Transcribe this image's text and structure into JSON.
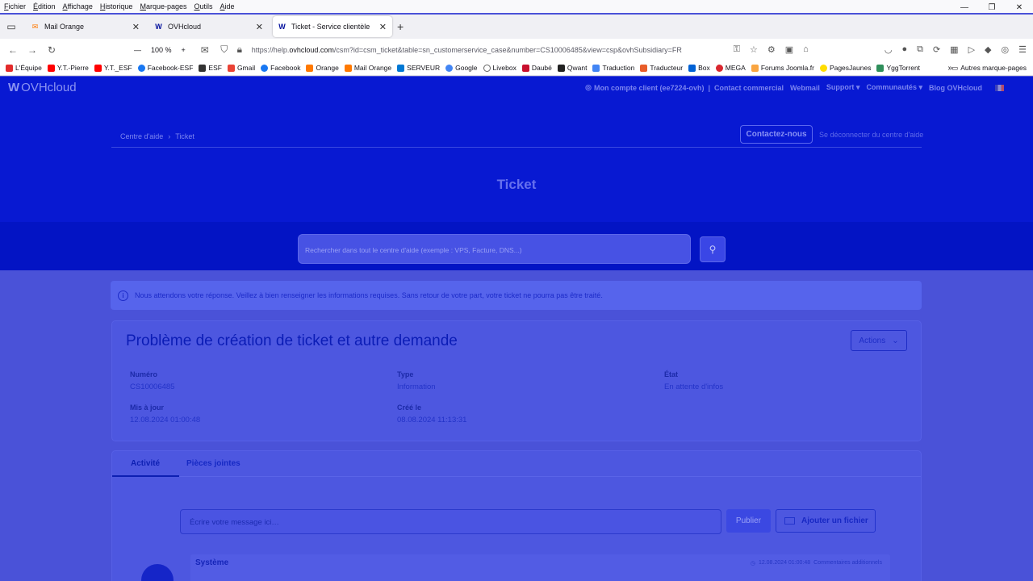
{
  "menubar": [
    "Fichier",
    "Édition",
    "Affichage",
    "Historique",
    "Marque-pages",
    "Outils",
    "Aide"
  ],
  "tabs": [
    {
      "label": "Mail Orange",
      "active": false
    },
    {
      "label": "OVHcloud",
      "active": false
    },
    {
      "label": "Ticket - Service clientèle",
      "active": true
    }
  ],
  "navbar": {
    "zoom": "100 %",
    "url_prefix": "https://help.",
    "url_host": "ovhcloud.com",
    "url_path": "/csm?id=csm_ticket&table=sn_customerservice_case&number=CS10006485&view=csp&ovhSubsidiary=FR"
  },
  "bookmarks": [
    {
      "label": "L'Équipe",
      "color": "#e32b2b"
    },
    {
      "label": "Y.T.-Pierre",
      "color": "#ff0000"
    },
    {
      "label": "Y.T._ESF",
      "color": "#ff0000"
    },
    {
      "label": "Facebook-ESF",
      "color": "#1877f2"
    },
    {
      "label": "ESF",
      "color": "#333333"
    },
    {
      "label": "Gmail",
      "color": "#ea4335"
    },
    {
      "label": "Facebook",
      "color": "#1877f2"
    },
    {
      "label": "Orange",
      "color": "#ff7900"
    },
    {
      "label": "Mail Orange",
      "color": "#ff7900"
    },
    {
      "label": "SERVEUR",
      "color": "#0078d4"
    },
    {
      "label": "Google",
      "color": "#4285f4"
    },
    {
      "label": "Livebox",
      "color": "#666666"
    },
    {
      "label": "Daubé",
      "color": "#c8102e"
    },
    {
      "label": "Qwant",
      "color": "#222222"
    },
    {
      "label": "Traduction",
      "color": "#4285f4"
    },
    {
      "label": "Traducteur",
      "color": "#e85d2a"
    },
    {
      "label": "Box",
      "color": "#0061d5"
    },
    {
      "label": "MEGA",
      "color": "#d9272e"
    },
    {
      "label": "Forums Joomla.fr",
      "color": "#f9a541"
    },
    {
      "label": "PagesJaunes",
      "color": "#ffdd00"
    },
    {
      "label": "YggTorrent",
      "color": "#2f8f5b"
    }
  ],
  "bookmarks_other": "Autres marque-pages",
  "site": {
    "logo": "OVHcloud",
    "topnav": {
      "account": "Mon compte client (ee7224-ovh)",
      "contact": "Contact commercial",
      "webmail": "Webmail",
      "support": "Support",
      "communities": "Communautés",
      "blog": "Blog OVHcloud"
    },
    "breadcrumb": {
      "home": "Centre d'aide",
      "current": "Ticket"
    },
    "contact_button": "Contactez-nous",
    "disconnect": "Se déconnecter du centre d'aide",
    "hero_title": "Ticket",
    "search_placeholder": "Rechercher dans tout le centre d'aide (exemple : VPS, Facture, DNS...)"
  },
  "alert": "Nous attendons votre réponse. Veillez à bien renseigner les informations requises. Sans retour de votre part, votre ticket ne pourra pas être traité.",
  "ticket": {
    "title": "Problème de création de ticket et autre demande",
    "actions": "Actions",
    "numero_label": "Numéro",
    "numero": "CS10006485",
    "type_label": "Type",
    "type": "Information",
    "etat_label": "État",
    "etat": "En attente d'infos",
    "maj_label": "Mis à jour",
    "maj": "12.08.2024 01:00:48",
    "cree_label": "Créé le",
    "cree": "08.08.2024 11:13:31"
  },
  "activity": {
    "tab_activity": "Activité",
    "tab_attachments": "Pièces jointes",
    "message_placeholder": "Écrire votre message ici…",
    "publish": "Publier",
    "attach": "Ajouter un fichier",
    "entry": {
      "author": "Système",
      "date": "12.08.2024 01:00:48",
      "kind": "Commentaires additionnels"
    }
  }
}
